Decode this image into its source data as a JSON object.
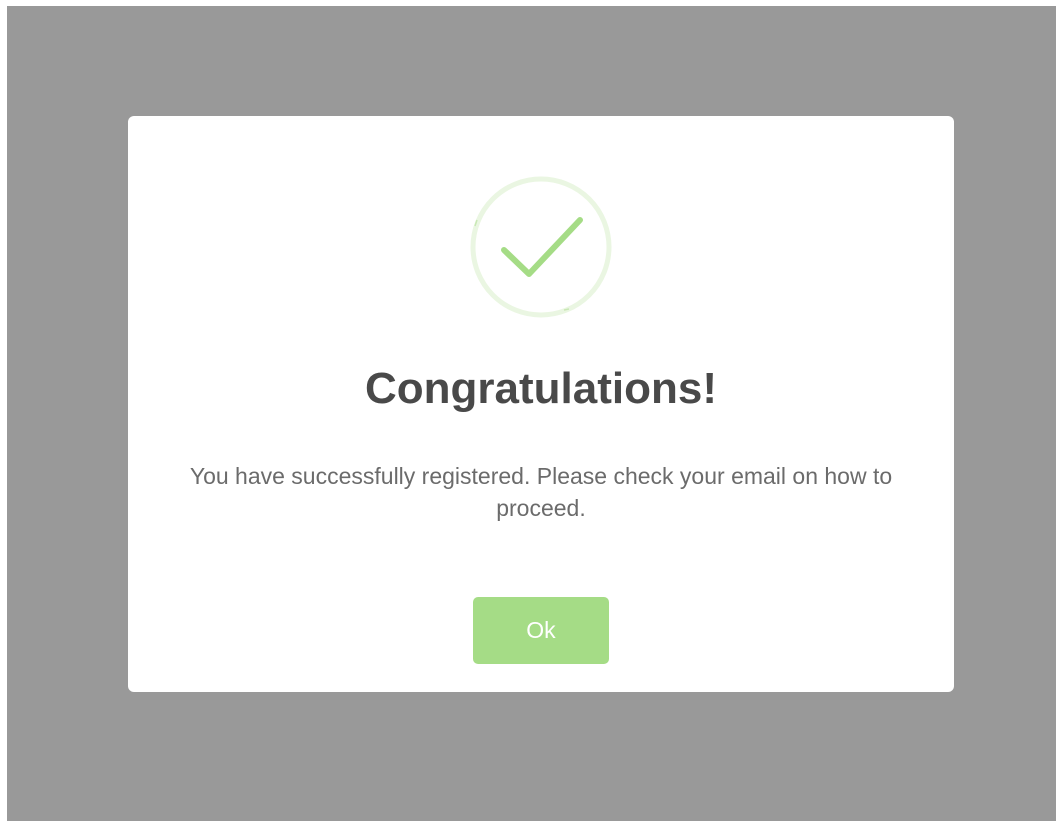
{
  "dialog": {
    "title": "Congratulations!",
    "message": "You have successfully registered. Please check your email on how to proceed.",
    "ok_label": "Ok",
    "icon": "success-check-icon"
  },
  "colors": {
    "overlay": "#999999",
    "dialog_background": "#ffffff",
    "accent": "#a5dc86",
    "icon_ring": "#eaf6e2",
    "title_text": "#494949",
    "message_text": "#6b6b6b"
  }
}
